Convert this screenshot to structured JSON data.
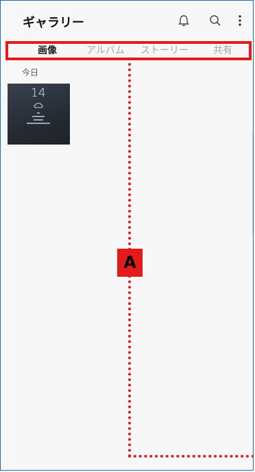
{
  "header": {
    "title": "ギャラリー",
    "icons": [
      "bell-icon",
      "search-icon",
      "more-vertical-icon"
    ]
  },
  "tabs": [
    {
      "label": "画像",
      "active": true
    },
    {
      "label": "アルバム",
      "active": false
    },
    {
      "label": "ストーリー",
      "active": false
    },
    {
      "label": "共有",
      "active": false
    }
  ],
  "section": {
    "date_label": "今日"
  },
  "thumbnail": {
    "time_text": "14"
  },
  "annotation": {
    "label": "A",
    "color": "#e31b1b"
  }
}
